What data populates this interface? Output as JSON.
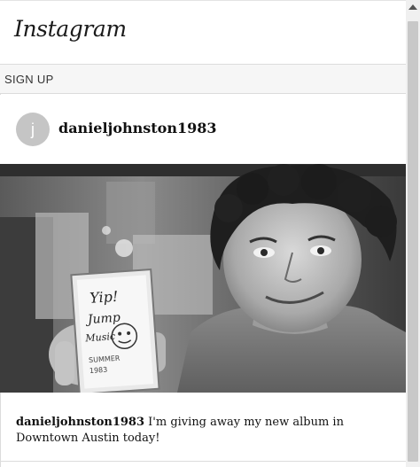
{
  "header": {
    "logo_text": "Instagram"
  },
  "signup": {
    "label": "SIGN UP"
  },
  "post": {
    "avatar_letter": "j",
    "username": "danieljohnston1983",
    "caption_username": "danieljohnston1983",
    "caption_text": " I'm giving away my new album in Downtown Austin today!",
    "cassette_text": "Yip! Jump Music"
  },
  "colors": {
    "avatar_bg": "#c5c5c5",
    "signup_bg": "#f6f6f6"
  }
}
